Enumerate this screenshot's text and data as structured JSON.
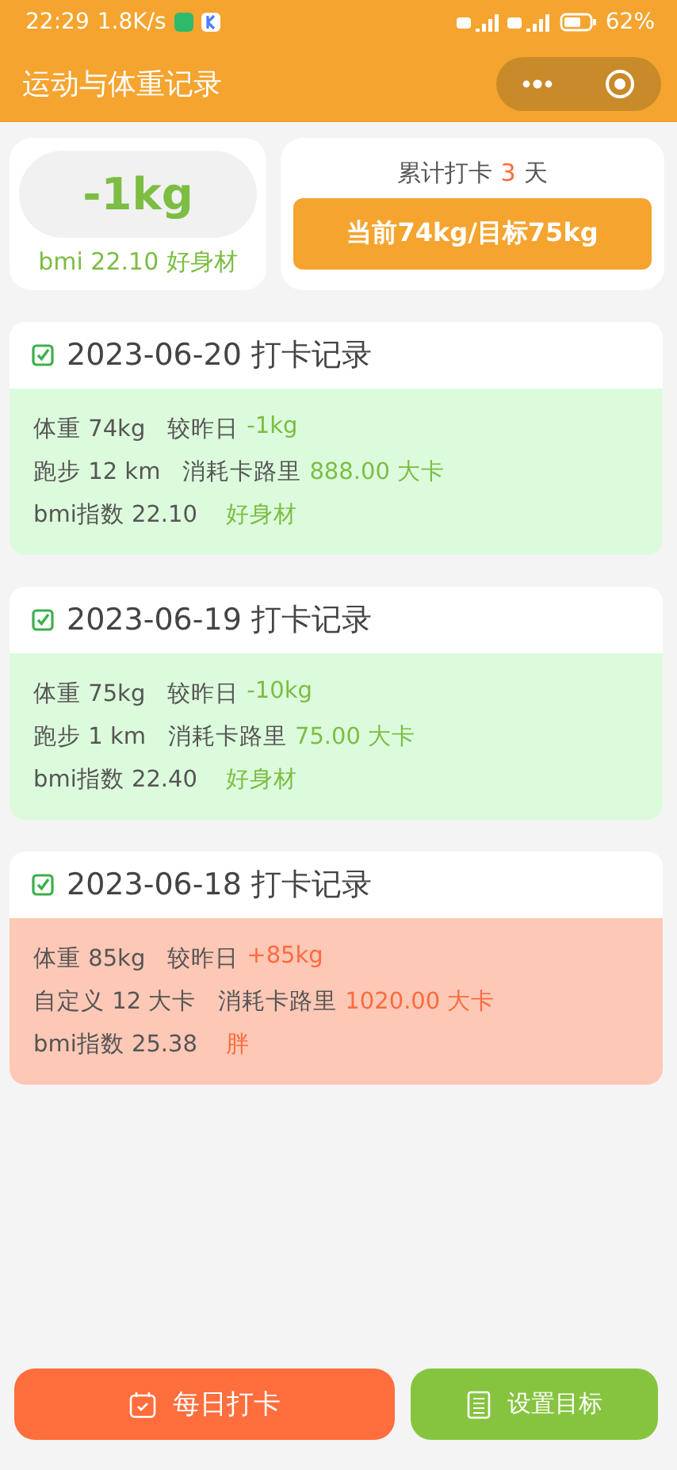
{
  "status_bar": {
    "time": "22:29",
    "speed": "1.8K/s",
    "battery": "62%"
  },
  "header": {
    "title": "运动与体重记录"
  },
  "summary": {
    "change": "-1kg",
    "bmi": "bmi 22.10 好身材",
    "streak_label": "累计打卡",
    "streak_count": "3",
    "streak_unit": "天",
    "goal_button": "当前74kg/目标75kg"
  },
  "records": [
    {
      "kind": "good",
      "checked": true,
      "title": "2023-06-20 打卡记录",
      "weight": "体重 74kg",
      "compare_label": "较昨日",
      "change": "-1kg",
      "activity": "跑步 12 km",
      "calorie_label": "消耗卡路里",
      "calories": "888.00 大卡",
      "bmi": "bmi指数 22.10",
      "verdict": "好身材"
    },
    {
      "kind": "good",
      "checked": true,
      "title": "2023-06-19 打卡记录",
      "weight": "体重 75kg",
      "compare_label": "较昨日",
      "change": "-10kg",
      "activity": "跑步 1 km",
      "calorie_label": "消耗卡路里",
      "calories": "75.00 大卡",
      "bmi": "bmi指数 22.40",
      "verdict": "好身材"
    },
    {
      "kind": "bad",
      "checked": true,
      "title": "2023-06-18 打卡记录",
      "weight": "体重 85kg",
      "compare_label": "较昨日",
      "change": "+85kg",
      "activity": "自定义 12 大卡",
      "calorie_label": "消耗卡路里",
      "calories": "1020.00 大卡",
      "bmi": "bmi指数 25.38",
      "verdict": "胖"
    }
  ],
  "actions": {
    "checkin": "每日打卡",
    "set_goal": "设置目标"
  }
}
